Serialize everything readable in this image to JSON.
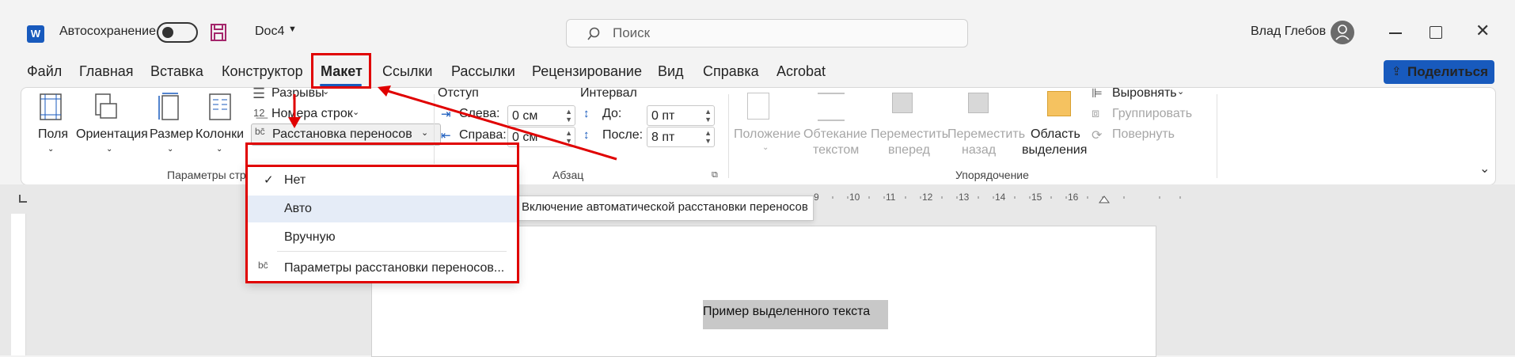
{
  "titlebar": {
    "autosave_label": "Автосохранение",
    "doc_name": "Doc4",
    "search_placeholder": "Поиск",
    "user_name": "Влад Глебов"
  },
  "menu": {
    "items": [
      "Файл",
      "Главная",
      "Вставка",
      "Конструктор",
      "Макет",
      "Ссылки",
      "Рассылки",
      "Рецензирование",
      "Вид",
      "Справка",
      "Acrobat"
    ],
    "active": "Макет",
    "share_label": "Поделиться"
  },
  "ribbon": {
    "page_setup": {
      "fields": "Поля",
      "orientation": "Ориентация",
      "size": "Размер",
      "columns": "Колонки",
      "breaks": "Разрывы",
      "line_numbers": "Номера строк",
      "hyphenation": "Расстановка переносов",
      "group_label": "Параметры стра"
    },
    "paragraph": {
      "indent_label": "Отступ",
      "spacing_label": "Интервал",
      "left_label": "Слева:",
      "left_value": "0 см",
      "right_label": "Справа:",
      "right_value": "0 см",
      "before_label": "До:",
      "before_value": "0 пт",
      "after_label": "После:",
      "after_value": "8 пт",
      "group_label": "Абзац"
    },
    "arrange": {
      "position_1": "Положение",
      "wrap_1": "Обтекание",
      "wrap_2": "текстом",
      "forward_1": "Переместить",
      "forward_2": "вперед",
      "backward_1": "Переместить",
      "backward_2": "назад",
      "selection_1": "Область",
      "selection_2": "выделения",
      "align": "Выровнять",
      "group": "Группировать",
      "rotate": "Повернуть",
      "group_label": "Упорядочение"
    }
  },
  "dropdown": {
    "items": [
      "Нет",
      "Авто",
      "Вручную",
      "Параметры расстановки переносов..."
    ],
    "checked": "Нет",
    "hovered": "Авто"
  },
  "tooltip": "Включение автоматической расстановки переносов",
  "ruler": {
    "numbers": [
      "9",
      "10",
      "11",
      "12",
      "13",
      "14",
      "15",
      "16"
    ]
  },
  "document": {
    "selected_text": "Пример выделенного текста"
  },
  "colors": {
    "accent": "#185abd",
    "annotation": "#e00000",
    "selection": "#c8c8c8"
  }
}
